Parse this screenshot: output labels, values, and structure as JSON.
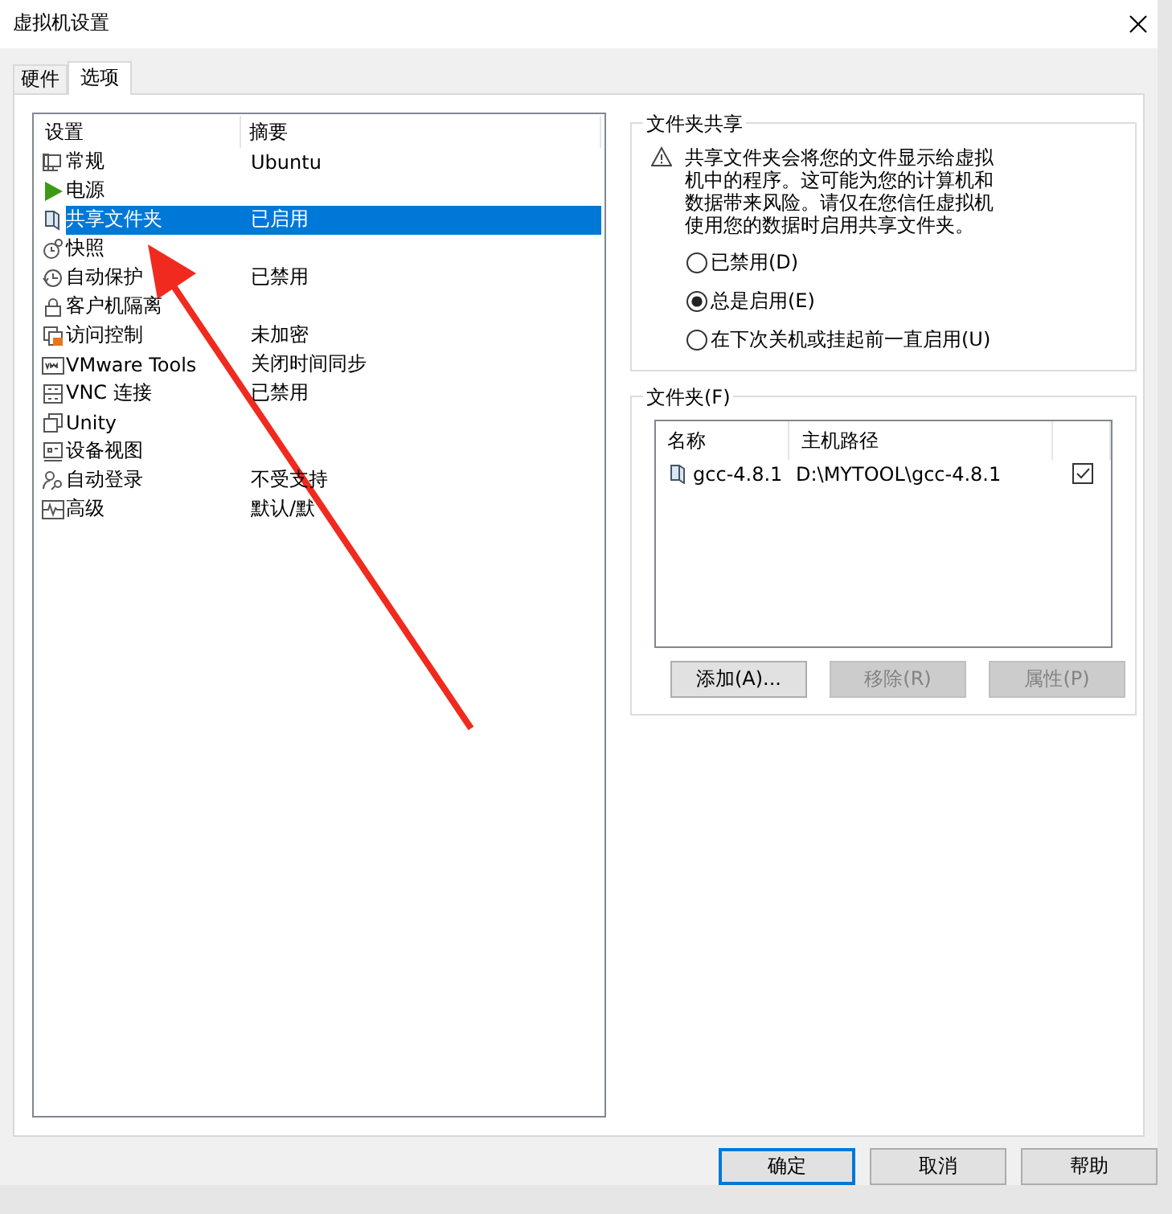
{
  "window": {
    "title": "虚拟机设置"
  },
  "tabs": [
    {
      "label": "硬件",
      "selected": false
    },
    {
      "label": "选项",
      "selected": true
    }
  ],
  "settings_list": {
    "columns": [
      "设置",
      "摘要"
    ],
    "rows": [
      {
        "name": "常规",
        "summary": "Ubuntu",
        "selected": false
      },
      {
        "name": "电源",
        "selected": false
      },
      {
        "name": "共享文件夹",
        "summary": "已启用",
        "selected": true
      },
      {
        "name": "快照",
        "selected": false
      },
      {
        "name": "自动保护",
        "summary": "已禁用",
        "selected": false
      },
      {
        "name": "客户机隔离",
        "selected": false
      },
      {
        "name": "访问控制",
        "summary": "未加密",
        "selected": false
      },
      {
        "name": "VMware Tools",
        "summary": "关闭时间同步",
        "selected": false
      },
      {
        "name": "VNC 连接",
        "summary": "已禁用",
        "selected": false
      },
      {
        "name": "Unity",
        "selected": false
      },
      {
        "name": "设备视图",
        "selected": false
      },
      {
        "name": "自动登录",
        "summary": "不受支持",
        "selected": false
      },
      {
        "name": "高级",
        "summary": "默认/默",
        "selected": false
      }
    ]
  },
  "sharing": {
    "title": "文件夹共享",
    "warning": "共享文件夹会将您的文件显示给虚拟机中的程序。这可能为您的计算机和数据带来风险。请仅在您信任虚拟机使用您的数据时启用共享文件夹。",
    "options": [
      {
        "label": "已禁用(D)",
        "selected": false
      },
      {
        "label": "总是启用(E)",
        "selected": true
      },
      {
        "label": "在下次关机或挂起前一直启用(U)",
        "selected": false
      }
    ]
  },
  "folders": {
    "title": "文件夹(F)",
    "columns": [
      "名称",
      "主机路径"
    ],
    "rows": [
      {
        "name": "gcc-4.8.1",
        "path": "D:\\MYTOOL\\gcc-4.8.1",
        "checked": true
      }
    ],
    "buttons": [
      {
        "label": "添加(A)...",
        "disabled": false
      },
      {
        "label": "移除(R)",
        "disabled": true
      },
      {
        "label": "属性(P)",
        "disabled": true
      }
    ]
  },
  "footer_buttons": [
    {
      "label": "确定",
      "focused": true
    },
    {
      "label": "取消",
      "focused": false
    },
    {
      "label": "帮助",
      "focused": false
    }
  ]
}
